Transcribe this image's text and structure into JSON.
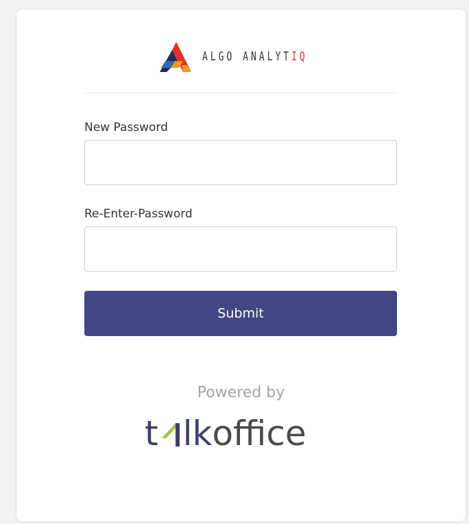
{
  "brand": {
    "logo_icon": "algo-analytiq-logo-icon",
    "name_main": "ALGO ANALYT",
    "name_accent": "IQ",
    "colors": {
      "accent_red": "#e3312a",
      "accent_orange": "#f39a1e",
      "accent_blue": "#2a6db5",
      "accent_navy": "#1f2b5c"
    }
  },
  "form": {
    "new_password": {
      "label": "New Password",
      "value": "",
      "placeholder": ""
    },
    "reenter_password": {
      "label": "Re-Enter-Password",
      "value": "",
      "placeholder": ""
    },
    "submit_label": "Submit",
    "submit_color": "#424683"
  },
  "footer": {
    "powered_by": "Powered by",
    "talkoffice": {
      "part1": "t",
      "part2": "lk",
      "part3": "office",
      "mark_icon": "talkoffice-a-mark-icon",
      "colors": {
        "navy": "#3d3f6e",
        "green": "#9ec63b",
        "grey": "#4a4a4a"
      }
    }
  }
}
